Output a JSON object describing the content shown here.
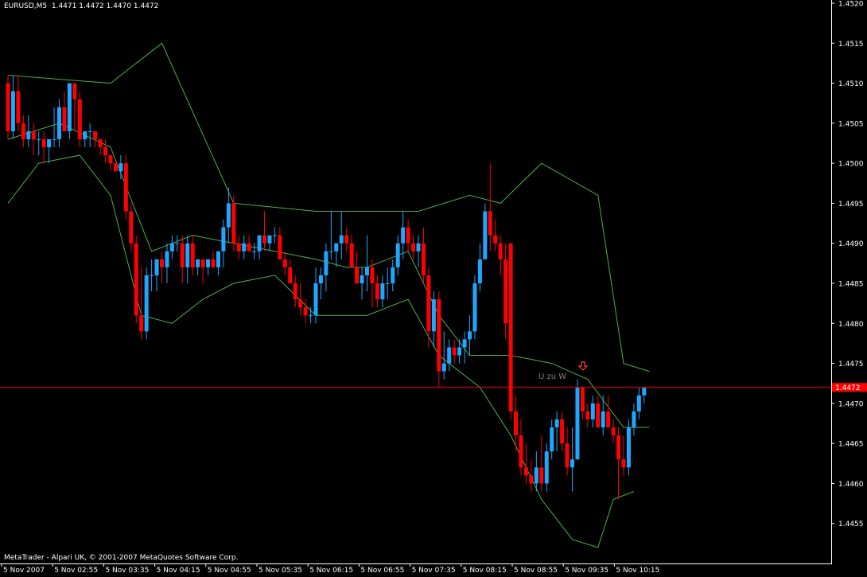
{
  "header": {
    "symbol_timeframe": "EURUSD,M5",
    "ohlc": "1.4471 1.4472 1.4470 1.4472"
  },
  "footer": {
    "copyright": "MetaTrader - Alpari UK, © 2001-2007 MetaQuotes Software Corp."
  },
  "annotation": {
    "text": "U zu W",
    "arrow_icon": "down-arrow-icon"
  },
  "current_price_label": "1.4472",
  "colors": {
    "background": "#000000",
    "bull": "#1ea7ff",
    "bear": "#ff0000",
    "bands": "#4caf50",
    "price_line": "#ff0000",
    "axis": "#ffffff",
    "annotation": "#808080"
  },
  "chart_data": {
    "type": "candlestick",
    "symbol": "EURUSD",
    "timeframe": "M5",
    "ylim": [
      1.445,
      1.452
    ],
    "y_ticks": [
      "1.4455",
      "1.4460",
      "1.4465",
      "1.4470",
      "1.4475",
      "1.4480",
      "1.4485",
      "1.4490",
      "1.4495",
      "1.4500",
      "1.4505",
      "1.4510",
      "1.4515",
      "1.4520"
    ],
    "x_ticks": [
      "5 Nov 2007",
      "5 Nov 02:55",
      "5 Nov 03:35",
      "5 Nov 04:15",
      "5 Nov 04:55",
      "5 Nov 05:35",
      "5 Nov 06:15",
      "5 Nov 06:55",
      "5 Nov 07:35",
      "5 Nov 08:15",
      "5 Nov 08:55",
      "5 Nov 09:35",
      "5 Nov 10:15"
    ],
    "current_price": 1.4472,
    "indicator": "Bollinger Bands",
    "candles": [
      {
        "o": 1.451,
        "h": 1.4511,
        "l": 1.4503,
        "c": 1.4504
      },
      {
        "o": 1.4504,
        "h": 1.4511,
        "l": 1.4503,
        "c": 1.4509
      },
      {
        "o": 1.4509,
        "h": 1.4511,
        "l": 1.4504,
        "c": 1.4505
      },
      {
        "o": 1.4505,
        "h": 1.4506,
        "l": 1.4502,
        "c": 1.4503
      },
      {
        "o": 1.4503,
        "h": 1.4506,
        "l": 1.4502,
        "c": 1.4504
      },
      {
        "o": 1.4504,
        "h": 1.4505,
        "l": 1.4501,
        "c": 1.4503
      },
      {
        "o": 1.4503,
        "h": 1.4504,
        "l": 1.4501,
        "c": 1.4503
      },
      {
        "o": 1.4503,
        "h": 1.4504,
        "l": 1.45,
        "c": 1.4502
      },
      {
        "o": 1.4502,
        "h": 1.4503,
        "l": 1.45,
        "c": 1.4503
      },
      {
        "o": 1.4503,
        "h": 1.4507,
        "l": 1.4502,
        "c": 1.4503
      },
      {
        "o": 1.4503,
        "h": 1.4508,
        "l": 1.4502,
        "c": 1.4507
      },
      {
        "o": 1.4507,
        "h": 1.4509,
        "l": 1.4504,
        "c": 1.4504
      },
      {
        "o": 1.4504,
        "h": 1.451,
        "l": 1.4503,
        "c": 1.451
      },
      {
        "o": 1.451,
        "h": 1.451,
        "l": 1.4504,
        "c": 1.4508
      },
      {
        "o": 1.4508,
        "h": 1.4509,
        "l": 1.4502,
        "c": 1.4503
      },
      {
        "o": 1.4503,
        "h": 1.4504,
        "l": 1.4502,
        "c": 1.4504
      },
      {
        "o": 1.4504,
        "h": 1.4505,
        "l": 1.4502,
        "c": 1.4504
      },
      {
        "o": 1.4504,
        "h": 1.4504,
        "l": 1.4502,
        "c": 1.4503
      },
      {
        "o": 1.4503,
        "h": 1.4503,
        "l": 1.4501,
        "c": 1.4502
      },
      {
        "o": 1.4502,
        "h": 1.4503,
        "l": 1.45,
        "c": 1.4501
      },
      {
        "o": 1.4501,
        "h": 1.4501,
        "l": 1.4499,
        "c": 1.45
      },
      {
        "o": 1.45,
        "h": 1.45,
        "l": 1.4499,
        "c": 1.4499
      },
      {
        "o": 1.4499,
        "h": 1.4501,
        "l": 1.4498,
        "c": 1.45
      },
      {
        "o": 1.45,
        "h": 1.4501,
        "l": 1.4493,
        "c": 1.4494
      },
      {
        "o": 1.4494,
        "h": 1.4495,
        "l": 1.4489,
        "c": 1.449
      },
      {
        "o": 1.449,
        "h": 1.4491,
        "l": 1.448,
        "c": 1.4481
      },
      {
        "o": 1.4481,
        "h": 1.4487,
        "l": 1.4478,
        "c": 1.4479
      },
      {
        "o": 1.4479,
        "h": 1.4487,
        "l": 1.4478,
        "c": 1.4486
      },
      {
        "o": 1.4486,
        "h": 1.4488,
        "l": 1.4484,
        "c": 1.4486
      },
      {
        "o": 1.4486,
        "h": 1.4488,
        "l": 1.4484,
        "c": 1.4488
      },
      {
        "o": 1.4488,
        "h": 1.4489,
        "l": 1.4485,
        "c": 1.4487
      },
      {
        "o": 1.4487,
        "h": 1.449,
        "l": 1.4485,
        "c": 1.4489
      },
      {
        "o": 1.4489,
        "h": 1.4491,
        "l": 1.4488,
        "c": 1.449
      },
      {
        "o": 1.449,
        "h": 1.4491,
        "l": 1.4489,
        "c": 1.449
      },
      {
        "o": 1.449,
        "h": 1.4491,
        "l": 1.4485,
        "c": 1.4487
      },
      {
        "o": 1.4487,
        "h": 1.4491,
        "l": 1.4485,
        "c": 1.449
      },
      {
        "o": 1.449,
        "h": 1.4491,
        "l": 1.4486,
        "c": 1.4487
      },
      {
        "o": 1.4487,
        "h": 1.4488,
        "l": 1.4486,
        "c": 1.4488
      },
      {
        "o": 1.4488,
        "h": 1.4488,
        "l": 1.4485,
        "c": 1.4487
      },
      {
        "o": 1.4487,
        "h": 1.4488,
        "l": 1.4486,
        "c": 1.4488
      },
      {
        "o": 1.4488,
        "h": 1.4489,
        "l": 1.4487,
        "c": 1.4487
      },
      {
        "o": 1.4487,
        "h": 1.4489,
        "l": 1.4486,
        "c": 1.4489
      },
      {
        "o": 1.4489,
        "h": 1.4493,
        "l": 1.4487,
        "c": 1.4492
      },
      {
        "o": 1.4492,
        "h": 1.4497,
        "l": 1.449,
        "c": 1.4495
      },
      {
        "o": 1.4495,
        "h": 1.4496,
        "l": 1.4489,
        "c": 1.449
      },
      {
        "o": 1.449,
        "h": 1.4491,
        "l": 1.4488,
        "c": 1.4489
      },
      {
        "o": 1.4489,
        "h": 1.4491,
        "l": 1.4488,
        "c": 1.449
      },
      {
        "o": 1.449,
        "h": 1.4491,
        "l": 1.4489,
        "c": 1.4489
      },
      {
        "o": 1.4489,
        "h": 1.449,
        "l": 1.4488,
        "c": 1.4489
      },
      {
        "o": 1.4489,
        "h": 1.4491,
        "l": 1.4488,
        "c": 1.4491
      },
      {
        "o": 1.4491,
        "h": 1.4494,
        "l": 1.4489,
        "c": 1.449
      },
      {
        "o": 1.449,
        "h": 1.4491,
        "l": 1.4489,
        "c": 1.4491
      },
      {
        "o": 1.4491,
        "h": 1.4492,
        "l": 1.449,
        "c": 1.4491
      },
      {
        "o": 1.4491,
        "h": 1.4492,
        "l": 1.4488,
        "c": 1.4488
      },
      {
        "o": 1.4488,
        "h": 1.4489,
        "l": 1.4486,
        "c": 1.4487
      },
      {
        "o": 1.4487,
        "h": 1.4488,
        "l": 1.4485,
        "c": 1.4485
      },
      {
        "o": 1.4485,
        "h": 1.4486,
        "l": 1.4482,
        "c": 1.4483
      },
      {
        "o": 1.4483,
        "h": 1.4485,
        "l": 1.4481,
        "c": 1.4482
      },
      {
        "o": 1.4482,
        "h": 1.4483,
        "l": 1.448,
        "c": 1.4481
      },
      {
        "o": 1.4481,
        "h": 1.4482,
        "l": 1.448,
        "c": 1.4481
      },
      {
        "o": 1.4481,
        "h": 1.4487,
        "l": 1.448,
        "c": 1.4485
      },
      {
        "o": 1.4485,
        "h": 1.4487,
        "l": 1.4483,
        "c": 1.4486
      },
      {
        "o": 1.4486,
        "h": 1.449,
        "l": 1.4484,
        "c": 1.4489
      },
      {
        "o": 1.4489,
        "h": 1.4494,
        "l": 1.4488,
        "c": 1.4489
      },
      {
        "o": 1.4489,
        "h": 1.449,
        "l": 1.4487,
        "c": 1.449
      },
      {
        "o": 1.449,
        "h": 1.4494,
        "l": 1.4488,
        "c": 1.4491
      },
      {
        "o": 1.4491,
        "h": 1.4492,
        "l": 1.4489,
        "c": 1.449
      },
      {
        "o": 1.449,
        "h": 1.4491,
        "l": 1.4487,
        "c": 1.4487
      },
      {
        "o": 1.4487,
        "h": 1.4489,
        "l": 1.4485,
        "c": 1.4485
      },
      {
        "o": 1.4485,
        "h": 1.4487,
        "l": 1.4483,
        "c": 1.4486
      },
      {
        "o": 1.4486,
        "h": 1.4491,
        "l": 1.4484,
        "c": 1.4487
      },
      {
        "o": 1.4487,
        "h": 1.4488,
        "l": 1.4482,
        "c": 1.4485
      },
      {
        "o": 1.4485,
        "h": 1.4486,
        "l": 1.4482,
        "c": 1.4483
      },
      {
        "o": 1.4483,
        "h": 1.4486,
        "l": 1.4482,
        "c": 1.4485
      },
      {
        "o": 1.4485,
        "h": 1.4487,
        "l": 1.4483,
        "c": 1.4485
      },
      {
        "o": 1.4485,
        "h": 1.4488,
        "l": 1.4484,
        "c": 1.4487
      },
      {
        "o": 1.4487,
        "h": 1.4491,
        "l": 1.4486,
        "c": 1.449
      },
      {
        "o": 1.449,
        "h": 1.4494,
        "l": 1.4488,
        "c": 1.4492
      },
      {
        "o": 1.4492,
        "h": 1.4493,
        "l": 1.4489,
        "c": 1.449
      },
      {
        "o": 1.449,
        "h": 1.4491,
        "l": 1.4488,
        "c": 1.4489
      },
      {
        "o": 1.4489,
        "h": 1.4491,
        "l": 1.4487,
        "c": 1.449
      },
      {
        "o": 1.449,
        "h": 1.4492,
        "l": 1.4485,
        "c": 1.4486
      },
      {
        "o": 1.4486,
        "h": 1.4487,
        "l": 1.4477,
        "c": 1.4479
      },
      {
        "o": 1.4479,
        "h": 1.4484,
        "l": 1.4477,
        "c": 1.4483
      },
      {
        "o": 1.4483,
        "h": 1.4484,
        "l": 1.4472,
        "c": 1.4474
      },
      {
        "o": 1.4474,
        "h": 1.4479,
        "l": 1.4473,
        "c": 1.4475
      },
      {
        "o": 1.4475,
        "h": 1.4478,
        "l": 1.4474,
        "c": 1.4477
      },
      {
        "o": 1.4477,
        "h": 1.4478,
        "l": 1.4475,
        "c": 1.4476
      },
      {
        "o": 1.4476,
        "h": 1.4478,
        "l": 1.4475,
        "c": 1.4477
      },
      {
        "o": 1.4477,
        "h": 1.4479,
        "l": 1.4475,
        "c": 1.4478
      },
      {
        "o": 1.4478,
        "h": 1.4481,
        "l": 1.4476,
        "c": 1.4479
      },
      {
        "o": 1.4479,
        "h": 1.4486,
        "l": 1.4478,
        "c": 1.4485
      },
      {
        "o": 1.4485,
        "h": 1.449,
        "l": 1.4484,
        "c": 1.4488
      },
      {
        "o": 1.4488,
        "h": 1.4495,
        "l": 1.4488,
        "c": 1.4494
      },
      {
        "o": 1.4494,
        "h": 1.45,
        "l": 1.4489,
        "c": 1.4491
      },
      {
        "o": 1.4491,
        "h": 1.4493,
        "l": 1.4489,
        "c": 1.449
      },
      {
        "o": 1.449,
        "h": 1.4491,
        "l": 1.4486,
        "c": 1.4488
      },
      {
        "o": 1.4488,
        "h": 1.449,
        "l": 1.4478,
        "c": 1.448
      },
      {
        "o": 1.449,
        "h": 1.449,
        "l": 1.4468,
        "c": 1.4469
      },
      {
        "o": 1.4469,
        "h": 1.4471,
        "l": 1.4464,
        "c": 1.4466
      },
      {
        "o": 1.4466,
        "h": 1.4468,
        "l": 1.4461,
        "c": 1.4462
      },
      {
        "o": 1.4462,
        "h": 1.4465,
        "l": 1.446,
        "c": 1.4461
      },
      {
        "o": 1.4461,
        "h": 1.4463,
        "l": 1.4459,
        "c": 1.446
      },
      {
        "o": 1.446,
        "h": 1.4464,
        "l": 1.4459,
        "c": 1.4462
      },
      {
        "o": 1.4462,
        "h": 1.4466,
        "l": 1.4459,
        "c": 1.446
      },
      {
        "o": 1.446,
        "h": 1.4465,
        "l": 1.4459,
        "c": 1.4464
      },
      {
        "o": 1.4464,
        "h": 1.4468,
        "l": 1.4463,
        "c": 1.4467
      },
      {
        "o": 1.4467,
        "h": 1.4469,
        "l": 1.4464,
        "c": 1.4468
      },
      {
        "o": 1.4468,
        "h": 1.4469,
        "l": 1.4464,
        "c": 1.4465
      },
      {
        "o": 1.4465,
        "h": 1.4467,
        "l": 1.4461,
        "c": 1.4462
      },
      {
        "o": 1.4462,
        "h": 1.4467,
        "l": 1.4459,
        "c": 1.4463
      },
      {
        "o": 1.4463,
        "h": 1.4473,
        "l": 1.4463,
        "c": 1.4472
      },
      {
        "o": 1.4472,
        "h": 1.4472,
        "l": 1.4468,
        "c": 1.4469
      },
      {
        "o": 1.4469,
        "h": 1.447,
        "l": 1.4467,
        "c": 1.4468
      },
      {
        "o": 1.4468,
        "h": 1.4471,
        "l": 1.4467,
        "c": 1.447
      },
      {
        "o": 1.447,
        "h": 1.4471,
        "l": 1.4467,
        "c": 1.4467
      },
      {
        "o": 1.4467,
        "h": 1.4471,
        "l": 1.4466,
        "c": 1.4469
      },
      {
        "o": 1.4469,
        "h": 1.4471,
        "l": 1.4467,
        "c": 1.4467
      },
      {
        "o": 1.4467,
        "h": 1.4468,
        "l": 1.4465,
        "c": 1.4466
      },
      {
        "o": 1.4466,
        "h": 1.4467,
        "l": 1.4458,
        "c": 1.4463
      },
      {
        "o": 1.4463,
        "h": 1.4466,
        "l": 1.4461,
        "c": 1.4462
      },
      {
        "o": 1.4462,
        "h": 1.4468,
        "l": 1.4461,
        "c": 1.4467
      },
      {
        "o": 1.4467,
        "h": 1.447,
        "l": 1.4466,
        "c": 1.4469
      },
      {
        "o": 1.4469,
        "h": 1.4472,
        "l": 1.4468,
        "c": 1.4471
      },
      {
        "o": 1.4471,
        "h": 1.4472,
        "l": 1.447,
        "c": 1.4472
      }
    ],
    "bands": {
      "upper": [
        [
          0,
          1.4511
        ],
        [
          20,
          1.451
        ],
        [
          30,
          1.4515
        ],
        [
          37,
          1.4505
        ],
        [
          44,
          1.4495
        ],
        [
          60,
          1.4494
        ],
        [
          70,
          1.4494
        ],
        [
          80,
          1.4494
        ],
        [
          90,
          1.4496
        ],
        [
          96,
          1.4495
        ],
        [
          104,
          1.45
        ],
        [
          115,
          1.4496
        ],
        [
          120,
          1.4475
        ],
        [
          125,
          1.4474
        ]
      ],
      "middle": [
        [
          0,
          1.4503
        ],
        [
          10,
          1.4505
        ],
        [
          20,
          1.4502
        ],
        [
          28,
          1.4489
        ],
        [
          36,
          1.4491
        ],
        [
          44,
          1.449
        ],
        [
          60,
          1.4488
        ],
        [
          66,
          1.4487
        ],
        [
          70,
          1.4487
        ],
        [
          78,
          1.4489
        ],
        [
          84,
          1.4481
        ],
        [
          90,
          1.4476
        ],
        [
          98,
          1.4476
        ],
        [
          106,
          1.4475
        ],
        [
          113,
          1.4473
        ],
        [
          120,
          1.4467
        ],
        [
          125,
          1.4467
        ]
      ],
      "lower": [
        [
          0,
          1.4495
        ],
        [
          6,
          1.45
        ],
        [
          14,
          1.4501
        ],
        [
          20,
          1.4496
        ],
        [
          26,
          1.4481
        ],
        [
          32,
          1.448
        ],
        [
          38,
          1.4483
        ],
        [
          44,
          1.4485
        ],
        [
          52,
          1.4486
        ],
        [
          60,
          1.4481
        ],
        [
          70,
          1.4481
        ],
        [
          78,
          1.4483
        ],
        [
          84,
          1.4476
        ],
        [
          92,
          1.4472
        ],
        [
          98,
          1.4466
        ],
        [
          104,
          1.4458
        ],
        [
          110,
          1.4453
        ],
        [
          115,
          1.4452
        ],
        [
          118,
          1.4458
        ],
        [
          122,
          1.4459
        ]
      ]
    },
    "annotation_bar_index": 111
  }
}
